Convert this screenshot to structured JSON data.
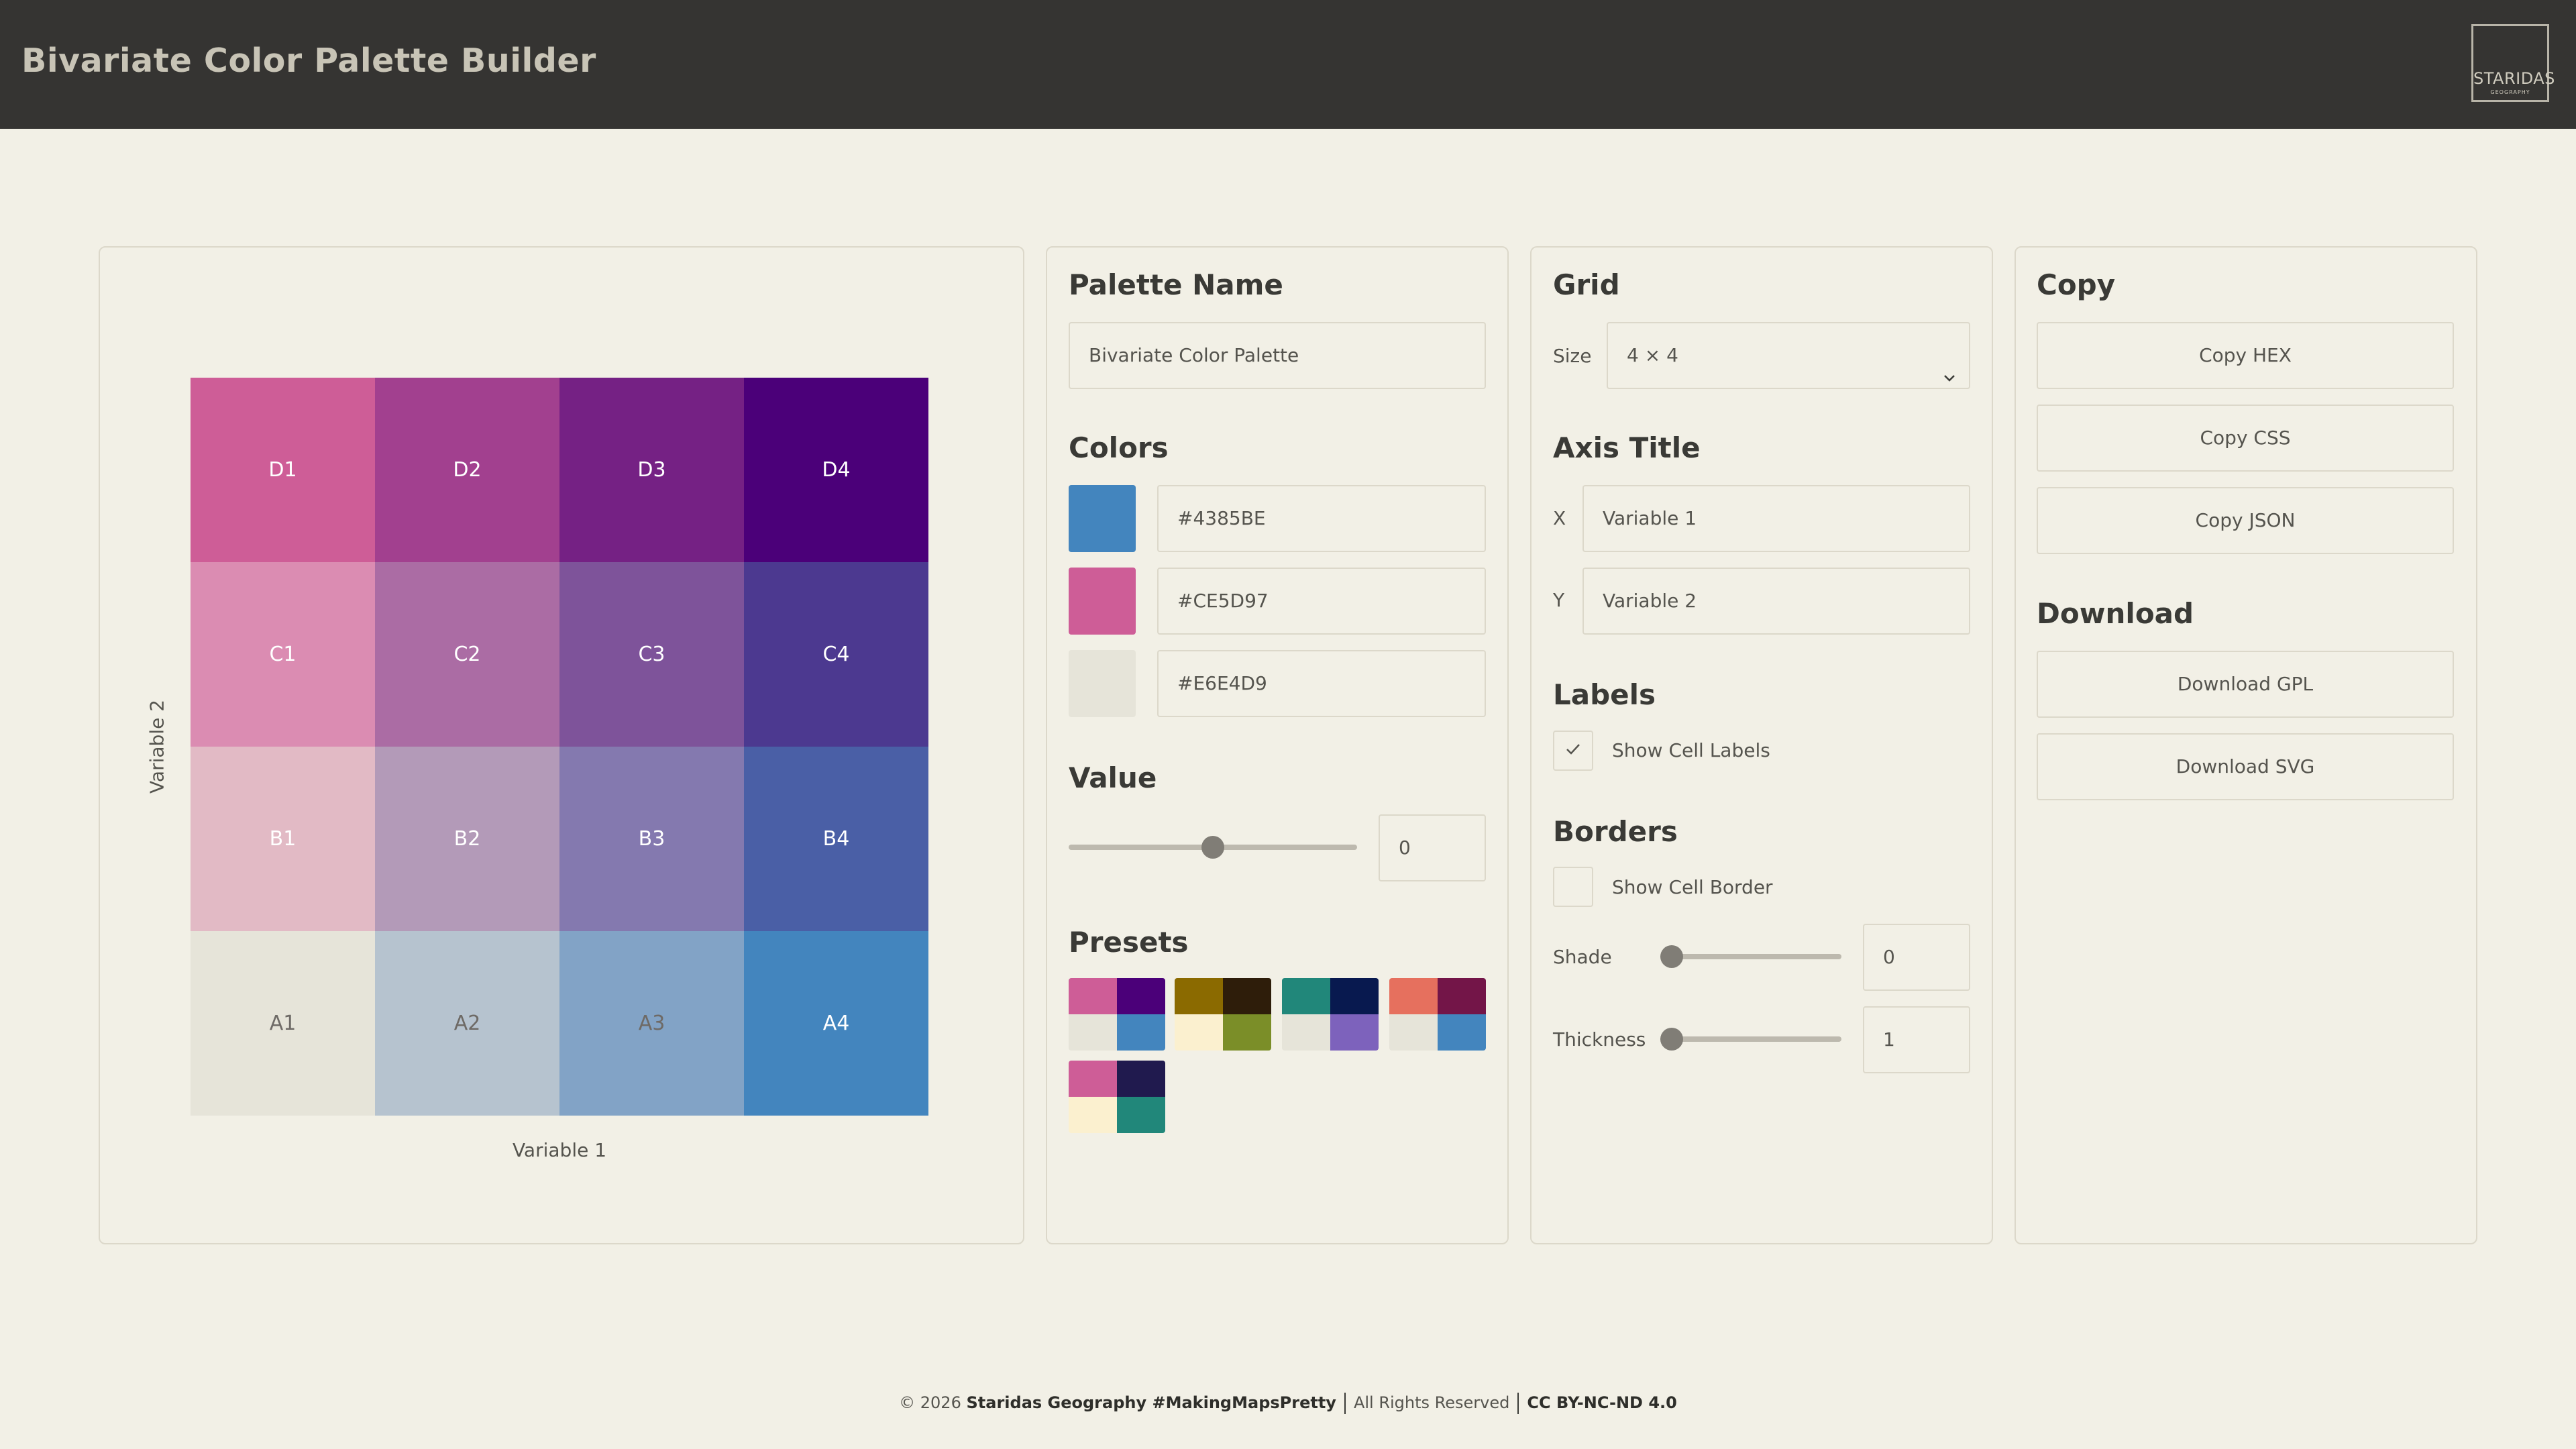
{
  "header": {
    "title": "Bivariate Color Palette Builder",
    "logo_text": "STARIDAS",
    "logo_sub": "GEOGRAPHY"
  },
  "preview": {
    "x_axis_label": "Variable 1",
    "y_axis_label": "Variable 2",
    "rows": [
      [
        {
          "label": "D1",
          "color": "#CE5D97"
        },
        {
          "label": "D2",
          "color": "#A2408F"
        },
        {
          "label": "D3",
          "color": "#752184"
        },
        {
          "label": "D4",
          "color": "#4B0079"
        }
      ],
      [
        {
          "label": "C1",
          "color": "#DB8CB2"
        },
        {
          "label": "C2",
          "color": "#AB6CA4"
        },
        {
          "label": "C3",
          "color": "#7E539A"
        },
        {
          "label": "C4",
          "color": "#4C3990"
        }
      ],
      [
        {
          "label": "B1",
          "color": "#E2BAC5"
        },
        {
          "label": "B2",
          "color": "#B39AB8"
        },
        {
          "label": "B3",
          "color": "#8479AF"
        },
        {
          "label": "B4",
          "color": "#4A5FA6"
        }
      ],
      [
        {
          "label": "A1",
          "color": "#E6E4D9"
        },
        {
          "label": "A2",
          "color": "#B6C3CF"
        },
        {
          "label": "A3",
          "color": "#82A3C6"
        },
        {
          "label": "A4",
          "color": "#4385BE"
        }
      ]
    ]
  },
  "palette": {
    "name_heading": "Palette Name",
    "name_value": "Bivariate Color Palette",
    "colors_heading": "Colors",
    "colors": [
      {
        "hex": "#4385BE"
      },
      {
        "hex": "#CE5D97"
      },
      {
        "hex": "#E6E4D9"
      }
    ],
    "value_heading": "Value",
    "value": "0",
    "value_level": 0.5,
    "presets_heading": "Presets",
    "presets": [
      [
        "#CE5D97",
        "#4B0079",
        "#E6E4D9",
        "#4385BE"
      ],
      [
        "#8B6A00",
        "#2E1D0A",
        "#FBF0CF",
        "#7B8E28"
      ],
      [
        "#21877A",
        "#08194F",
        "#E6E4D9",
        "#7D62BC"
      ],
      [
        "#E6705E",
        "#731548",
        "#E6E4D9",
        "#4385BE"
      ],
      [
        "#CE5D97",
        "#201A4E",
        "#FBF0CF",
        "#21877A"
      ]
    ]
  },
  "grid_settings": {
    "grid_heading": "Grid",
    "size_label": "Size",
    "size_value": "4 × 4",
    "axis_heading": "Axis Title",
    "x_label": "X",
    "x_value": "Variable 1",
    "y_label": "Y",
    "y_value": "Variable 2",
    "labels_heading": "Labels",
    "show_cell_labels": "Show Cell Labels",
    "show_cell_labels_checked": true,
    "borders_heading": "Borders",
    "show_cell_border": "Show Cell Border",
    "show_cell_border_checked": false,
    "shade_label": "Shade",
    "shade_value": "0",
    "thickness_label": "Thickness",
    "thickness_value": "1"
  },
  "export": {
    "copy_heading": "Copy",
    "copy_hex": "Copy HEX",
    "copy_css": "Copy CSS",
    "copy_json": "Copy JSON",
    "download_heading": "Download",
    "download_gpl": "Download GPL",
    "download_svg": "Download SVG"
  },
  "footer": {
    "copyright": "© 2026",
    "org": "Staridas Geography #MakingMapsPretty",
    "rights": "All Rights Reserved",
    "license": "CC BY-NC-ND 4.0"
  }
}
